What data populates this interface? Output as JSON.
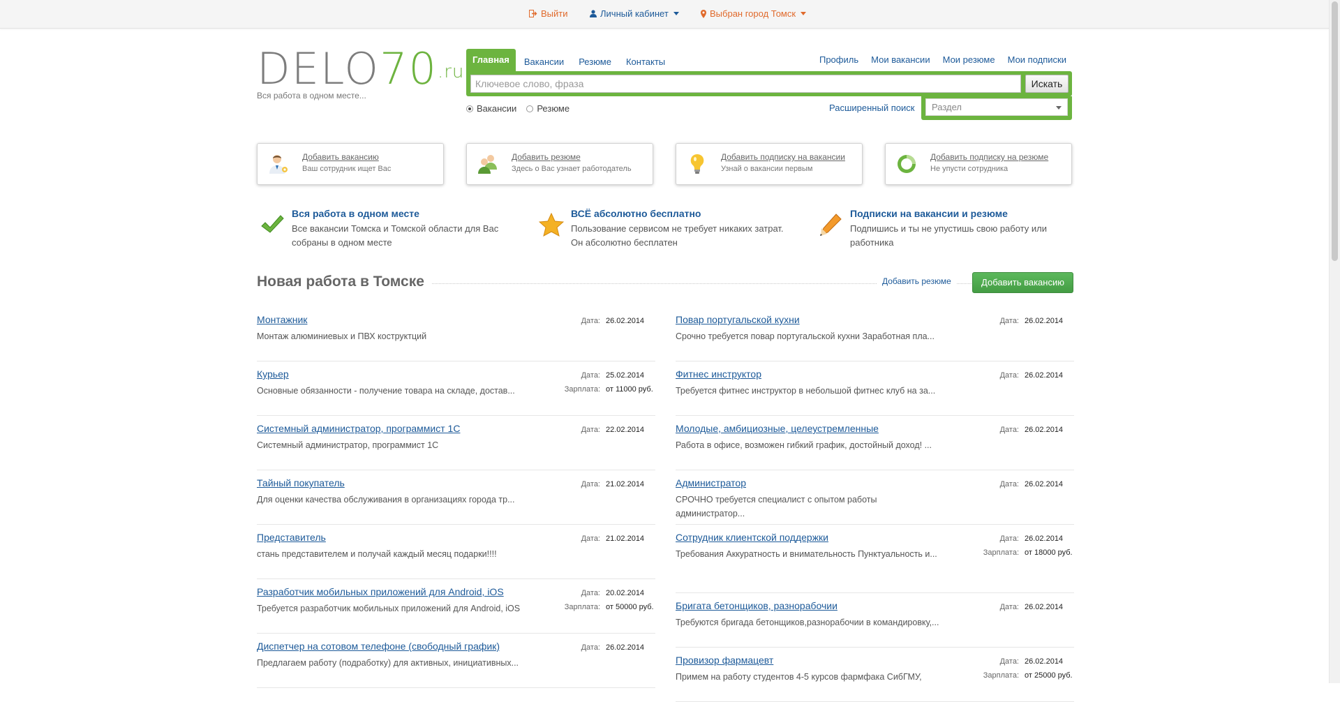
{
  "topbar": {
    "logout": "Выйти",
    "cabinet": "Личный кабинет",
    "city": "Выбран город Томск"
  },
  "logo": {
    "brand_gray": "DELO",
    "brand_green": "70",
    "brand_ru": ".ru",
    "slogan": "Вся работа в одном месте..."
  },
  "nav": {
    "tabs": [
      "Главная",
      "Вакансии",
      "Резюме",
      "Контакты"
    ],
    "right": [
      "Профиль",
      "Мои вакансии",
      "Мои резюме",
      "Мои подписки"
    ]
  },
  "search": {
    "placeholder": "Ключевое слово, фраза",
    "button": "Искать",
    "radio_vacancies": "Вакансии",
    "radio_resume": "Резюме",
    "advanced": "Расширенный поиск",
    "section_placeholder": "Раздел"
  },
  "cards": [
    {
      "title": "Добавить вакансию",
      "sub": "Ваш сотрудник ищет Вас",
      "icon": "employee-icon"
    },
    {
      "title": "Добавить резюме",
      "sub": "Здесь о Вас узнает работодатель",
      "icon": "users-icon"
    },
    {
      "title": "Добавить подписку на вакансии",
      "sub": "Узнай о вакансии первым",
      "icon": "lightbulb-icon"
    },
    {
      "title": "Добавить подписку на резюме",
      "sub": "Не упусти сотрудника",
      "icon": "ring-icon"
    }
  ],
  "features": [
    {
      "title": "Вся работа в одном месте",
      "desc": "Все вакансии Томска и Томской области для Вас собраны в одном месте",
      "icon": "checkmark-icon"
    },
    {
      "title": "ВСЁ абсолютно бесплатно",
      "desc": "Пользование сервисом не требует никаких затрат. Он абсолютно бесплатен",
      "icon": "star-icon"
    },
    {
      "title": "Подписки на вакансии и резюме",
      "desc": "Подпишись и ты не упустишь свою работу или работника",
      "icon": "pencil-icon"
    }
  ],
  "section": {
    "title": "Новая работа в Томске",
    "add_resume": "Добавить резюме",
    "add_vacancy": "Добавить вакансию"
  },
  "labels": {
    "date": "Дата:",
    "salary": "Зарплата:"
  },
  "jobs_left": [
    {
      "title": "Монтажник",
      "desc": "Монтаж алюминиевых и ПВХ коструктций",
      "date": "26.02.2014",
      "salary": ""
    },
    {
      "title": "Курьер",
      "desc": "Основные обязанности - получение товара на складе, достав...",
      "date": "25.02.2014",
      "salary": "от 11000 руб."
    },
    {
      "title": "Системный администратор, программист 1С",
      "desc": "Системный администратор, программист 1С",
      "date": "22.02.2014",
      "salary": ""
    },
    {
      "title": "Тайный покупатель",
      "desc": "Для оценки качества обслуживания в организациях города тр...",
      "date": "21.02.2014",
      "salary": ""
    },
    {
      "title": "Представитель",
      "desc": "стань представителем и получай каждый месяц подарки!!!!",
      "date": "21.02.2014",
      "salary": ""
    },
    {
      "title": "Разработчик мобильных приложений для Android, iOS",
      "desc": "Требуется разработчик мобильных приложений для Android, iOS",
      "date": "20.02.2014",
      "salary": "от 50000 руб."
    },
    {
      "title": "Диспетчер на сотовом телефоне (свободный график)",
      "desc": "Предлагаем работу (подработку) для активных, инициативных...",
      "date": "26.02.2014",
      "salary": ""
    }
  ],
  "jobs_right": [
    {
      "title": "Повар португальской кухни",
      "desc": "Срочно требуется повар португальской кухни Заработная пла...",
      "date": "26.02.2014",
      "salary": ""
    },
    {
      "title": "Фитнес инструктор",
      "desc": "Требуется фитнес инструктор в небольшой фитнес клуб на за...",
      "date": "26.02.2014",
      "salary": ""
    },
    {
      "title": "Молодые, амбициозные, целеустремленные",
      "desc": "Работа в офисе, возможен гибкий график, достойный доход! ...",
      "date": "26.02.2014",
      "salary": ""
    },
    {
      "title": "Администратор",
      "desc": "СРОЧНО требуется специалист с опытом работы администратор...",
      "date": "26.02.2014",
      "salary": ""
    },
    {
      "title": "Сотрудник клиентской поддержки",
      "desc": "Требования Аккуратность и внимательность Пунктуальность и...",
      "date": "26.02.2014",
      "salary": "от 18000 руб."
    },
    {
      "title": "Бригата бетонщиков, разнорабочии",
      "desc": "Требуются бригада бетонщиков,разнорабочии в командировку,...",
      "date": "26.02.2014",
      "salary": ""
    },
    {
      "title": "Провизор фармацевт",
      "desc": "Примем на работу студентов 4-5 курсов фармфака СибГМУ,",
      "date": "26.02.2014",
      "salary": "от 25000 руб."
    }
  ],
  "colors": {
    "green": "#6cb43f",
    "link": "#1d5a99",
    "orange": "#e06a2c"
  }
}
